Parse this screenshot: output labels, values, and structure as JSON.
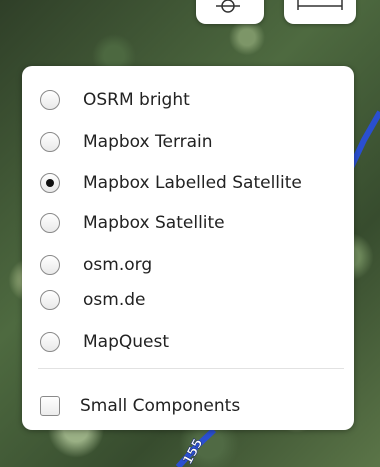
{
  "layers": {
    "options": [
      {
        "label": "OSRM bright",
        "selected": false
      },
      {
        "label": "Mapbox Terrain",
        "selected": false
      },
      {
        "label": "Mapbox Labelled Satellite",
        "selected": true
      },
      {
        "label": "Mapbox Satellite",
        "selected": false
      },
      {
        "label": "osm.org",
        "selected": false
      },
      {
        "label": "osm.de",
        "selected": false
      },
      {
        "label": "MapQuest",
        "selected": false
      }
    ],
    "overlay": {
      "label": "Small Components",
      "checked": false
    }
  },
  "map": {
    "road_label": "155",
    "road_color": "#2a4fd0"
  }
}
